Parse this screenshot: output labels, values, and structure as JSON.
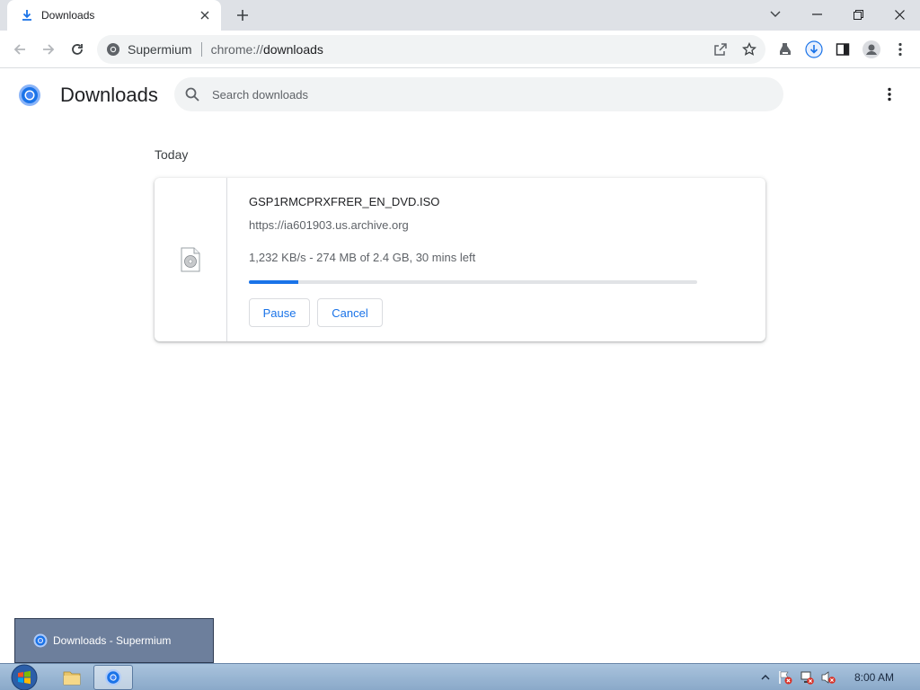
{
  "tab": {
    "title": "Downloads"
  },
  "toolbar": {
    "site_name": "Supermium",
    "url_scheme": "chrome://",
    "url_host": "downloads"
  },
  "page": {
    "title": "Downloads",
    "search_placeholder": "Search downloads"
  },
  "section": {
    "label": "Today"
  },
  "download": {
    "filename": "GSP1RMCPRXFRER_EN_DVD.ISO",
    "origin": "https://ia601903.us.archive.org",
    "status": "1,232 KB/s - 274 MB of 2.4 GB, 30 mins left",
    "progress_fraction": 0.11,
    "pause_label": "Pause",
    "cancel_label": "Cancel"
  },
  "taskbar": {
    "preview_label": "Downloads - Supermium",
    "clock": "8:00 AM"
  },
  "colors": {
    "accent": "#1a73e8",
    "tabstrip": "#dee1e6",
    "omnibox": "#f1f3f4"
  },
  "icons": [
    "download-icon",
    "close-icon",
    "plus-icon",
    "chevron-down-icon",
    "minimize-icon",
    "restore-icon",
    "back-icon",
    "forward-icon",
    "reload-icon",
    "site-info-icon",
    "share-icon",
    "star-icon",
    "extension-icon",
    "downloads-toolbar-icon",
    "side-panel-icon",
    "profile-icon",
    "menu-icon",
    "search-icon",
    "disc-file-icon",
    "windows-start-icon",
    "explorer-icon",
    "browser-icon"
  ]
}
